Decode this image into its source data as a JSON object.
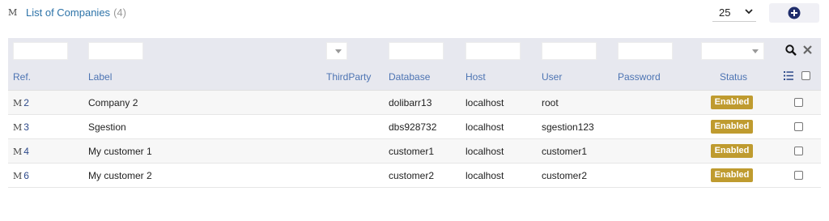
{
  "header": {
    "icon": "module-icon",
    "title": "List of Companies",
    "count": "(4)",
    "page_size": "25"
  },
  "columns": {
    "ref": "Ref.",
    "label": "Label",
    "thirdparty": "ThirdParty",
    "database": "Database",
    "host": "Host",
    "user": "User",
    "password": "Password",
    "status": "Status"
  },
  "rows": [
    {
      "ref_icon": "M",
      "ref": "2",
      "label": "Company 2",
      "database": "dolibarr13",
      "host": "localhost",
      "user": "root",
      "status": "Enabled"
    },
    {
      "ref_icon": "M",
      "ref": "3",
      "label": "Sgestion",
      "database": "dbs928732",
      "host": "localhost",
      "user": "sgestion123",
      "status": "Enabled"
    },
    {
      "ref_icon": "M",
      "ref": "4",
      "label": "My customer 1",
      "database": "customer1",
      "host": "localhost",
      "user": "customer1",
      "status": "Enabled"
    },
    {
      "ref_icon": "M",
      "ref": "6",
      "label": "My customer 2",
      "database": "customer2",
      "host": "localhost",
      "user": "customer2",
      "status": "Enabled"
    }
  ],
  "colors": {
    "link": "#2d73a8",
    "header_bg": "#e7e8ef",
    "badge_bg": "#bf9b2f",
    "column_header": "#4d74b3"
  }
}
